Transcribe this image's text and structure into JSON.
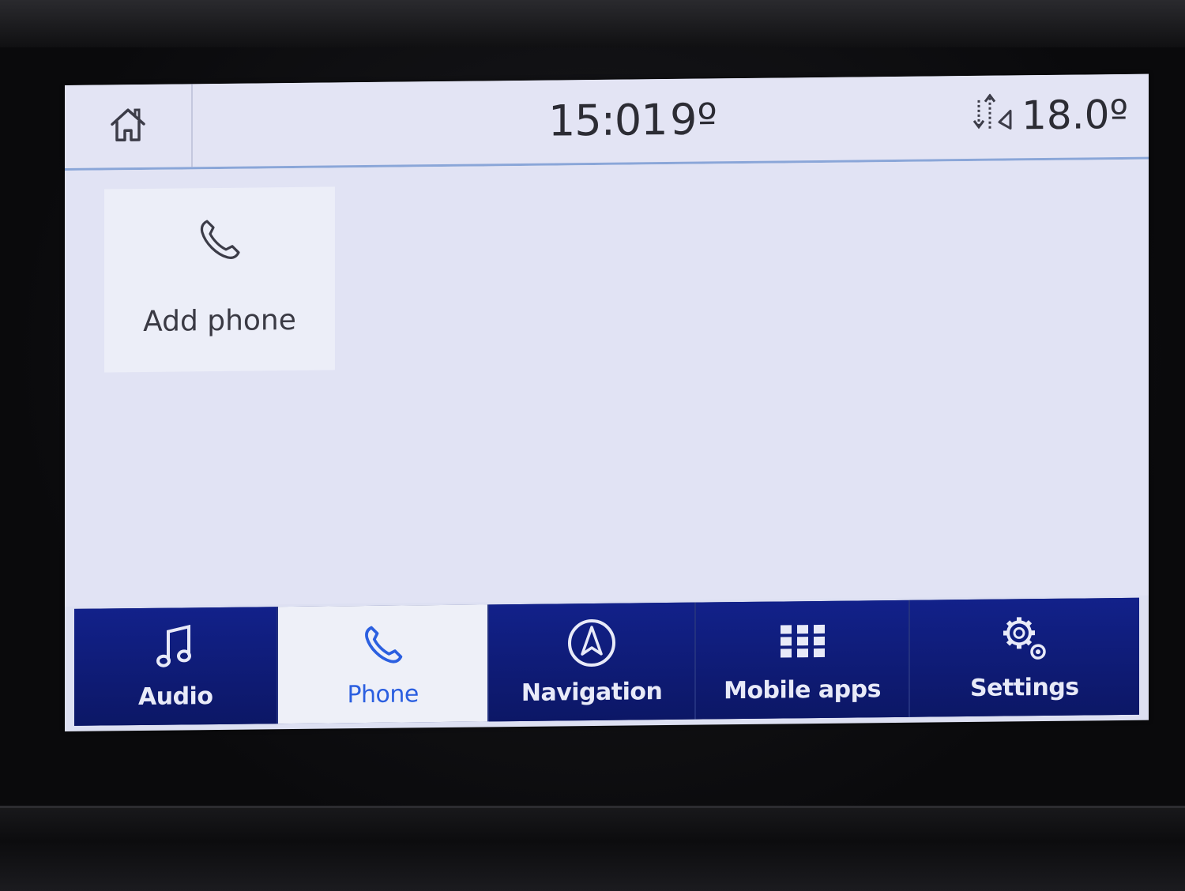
{
  "status_bar": {
    "time": "15:01",
    "outside_temperature": "9º",
    "climate_temperature": "18.0º",
    "home_icon": "home-icon",
    "fan_icon": "airflow-icon"
  },
  "content": {
    "add_phone": {
      "label": "Add phone",
      "icon": "phone-icon"
    }
  },
  "nav": {
    "active": "Phone",
    "items": [
      {
        "label": "Audio",
        "icon": "music-note-icon"
      },
      {
        "label": "Phone",
        "icon": "phone-icon"
      },
      {
        "label": "Navigation",
        "icon": "compass-icon"
      },
      {
        "label": "Mobile apps",
        "icon": "grid-icon"
      },
      {
        "label": "Settings",
        "icon": "gear-icon"
      }
    ]
  },
  "colors": {
    "screen_background": "#dde0f2",
    "nav_background": "#0d1a6e",
    "active_tab_text": "#2b5fe0"
  }
}
